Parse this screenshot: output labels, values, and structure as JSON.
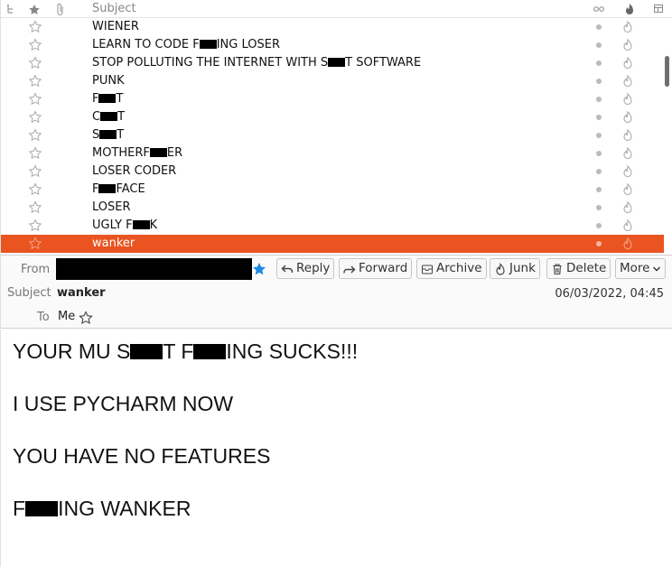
{
  "list": {
    "header": {
      "subject": "Subject"
    },
    "messages": [
      {
        "parts": [
          "WIENER"
        ]
      },
      {
        "parts": [
          "LEARN TO CODE F",
          "#",
          "ING LOSER"
        ]
      },
      {
        "parts": [
          "STOP POLLUTING THE INTERNET WITH S",
          "#",
          "T SOFTWARE"
        ]
      },
      {
        "parts": [
          "PUNK"
        ]
      },
      {
        "parts": [
          "F",
          "#",
          "T"
        ]
      },
      {
        "parts": [
          "C",
          "#",
          "T"
        ]
      },
      {
        "parts": [
          "S",
          "#",
          "T"
        ]
      },
      {
        "parts": [
          "MOTHERF",
          "#",
          "ER"
        ]
      },
      {
        "parts": [
          "LOSER CODER"
        ]
      },
      {
        "parts": [
          "F",
          "#",
          "FACE"
        ]
      },
      {
        "parts": [
          "LOSER"
        ]
      },
      {
        "parts": [
          "UGLY F",
          "#",
          "K"
        ]
      },
      {
        "parts": [
          "wanker"
        ],
        "selected": true
      }
    ]
  },
  "header": {
    "from_label": "From",
    "subject_label": "Subject",
    "subject": "wanker",
    "to_label": "To",
    "to": "Me",
    "date": "06/03/2022, 04:45",
    "buttons": {
      "reply": "Reply",
      "forward": "Forward",
      "archive": "Archive",
      "junk": "Junk",
      "delete": "Delete",
      "more": "More"
    }
  },
  "body": {
    "lines": [
      {
        "parts": [
          "YOUR MU S",
          "#",
          "T F",
          "#",
          "ING SUCKS!!!"
        ]
      },
      {
        "parts": [
          "I USE PYCHARM NOW"
        ]
      },
      {
        "parts": [
          "YOU HAVE NO FEATURES"
        ]
      },
      {
        "parts": [
          "F",
          "#",
          "ING WANKER"
        ]
      }
    ]
  },
  "colors": {
    "selected_row": "#e95420",
    "accent_star": "#1e88e5"
  }
}
